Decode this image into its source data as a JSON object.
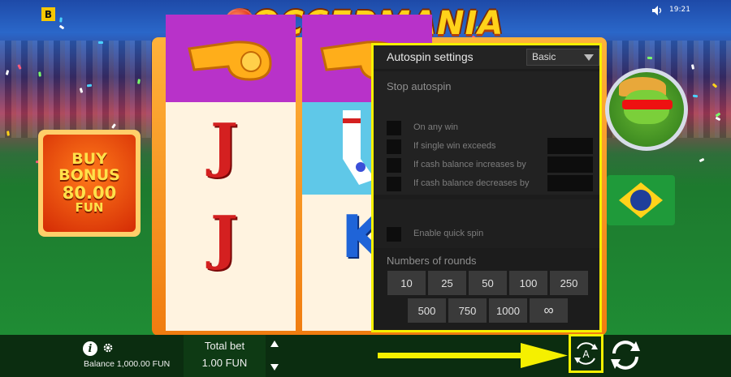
{
  "brand_badge": "B",
  "game_title": "SOCCERMANIA",
  "status": {
    "time": "19:21"
  },
  "buy_bonus": {
    "line1": "BUY",
    "line2": "BONUS",
    "price": "80.00",
    "currency": "FUN"
  },
  "reels": {
    "letter_j": "J",
    "letter_k": "K"
  },
  "autospin": {
    "title": "Autospin settings",
    "mode": "Basic",
    "stop_label": "Stop autospin",
    "options": [
      "On any win",
      "If single win exceeds",
      "If cash balance increases by",
      "If cash balance decreases by"
    ],
    "quick_spin": "Enable quick spin",
    "rounds_label": "Numbers of rounds",
    "rounds_row1": [
      "10",
      "25",
      "50",
      "100",
      "250"
    ],
    "rounds_row2": [
      "500",
      "750",
      "1000",
      "∞"
    ]
  },
  "footer": {
    "balance": "Balance 1,000.00 FUN",
    "total_bet_label": "Total bet",
    "total_bet_value": "1.00 FUN",
    "autospin_button": "A"
  },
  "colors": {
    "highlight": "#f5f000",
    "panel_bg": "#1c1c1c",
    "bottom_bar": "#0b2d10"
  },
  "icons": [
    "sound-icon",
    "info-icon",
    "gear-icon",
    "autospin-icon",
    "spin-icon",
    "arrow-right-icon"
  ]
}
